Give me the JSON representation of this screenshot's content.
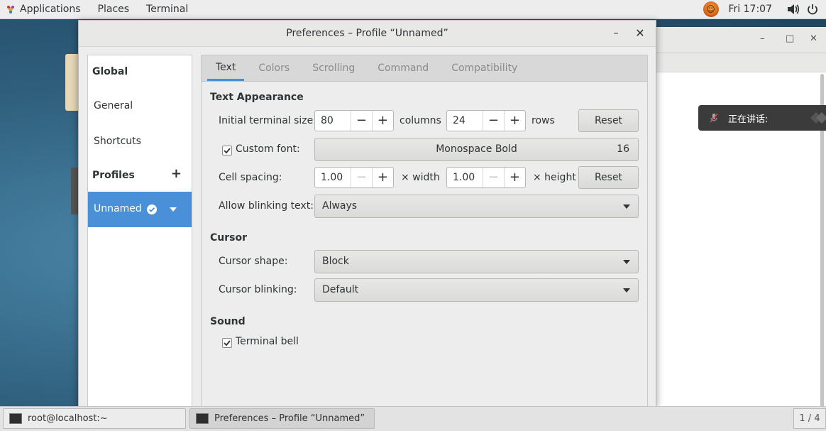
{
  "topbar": {
    "applications": "Applications",
    "places": "Places",
    "terminal": "Terminal",
    "clock": "Fri 17:07"
  },
  "notification": {
    "text": "正在讲话:"
  },
  "dialog": {
    "title": "Preferences – Profile “Unnamed”",
    "minimize": "–",
    "close": "✕"
  },
  "sidebar": {
    "global": "Global",
    "general": "General",
    "shortcuts": "Shortcuts",
    "profiles": "Profiles",
    "add": "+",
    "selected_profile": "Unnamed"
  },
  "tabs": [
    "Text",
    "Colors",
    "Scrolling",
    "Command",
    "Compatibility"
  ],
  "text_appearance": {
    "heading": "Text Appearance",
    "initial_size_label": "Initial terminal size:",
    "columns_value": "80",
    "columns_label": "columns",
    "rows_value": "24",
    "rows_label": "rows",
    "reset": "Reset",
    "custom_font_label": "Custom font:",
    "custom_font_checked": true,
    "font_name": "Monospace Bold",
    "font_size": "16",
    "cell_spacing_label": "Cell spacing:",
    "width_value": "1.00",
    "width_label": "× width",
    "height_value": "1.00",
    "height_label": "× height",
    "reset2": "Reset",
    "blinking_label": "Allow blinking text:",
    "blinking_value": "Always"
  },
  "cursor": {
    "heading": "Cursor",
    "shape_label": "Cursor shape:",
    "shape_value": "Block",
    "blinking_label": "Cursor blinking:",
    "blinking_value": "Default"
  },
  "sound": {
    "heading": "Sound",
    "bell_label": "Terminal bell",
    "bell_checked": true
  },
  "taskbar": {
    "task1": "root@localhost:~",
    "task2": "Preferences – Profile “Unnamed”",
    "workspace": "1 / 4"
  },
  "colors": {
    "accent": "#4a90d9",
    "topbar": "#ededed"
  }
}
